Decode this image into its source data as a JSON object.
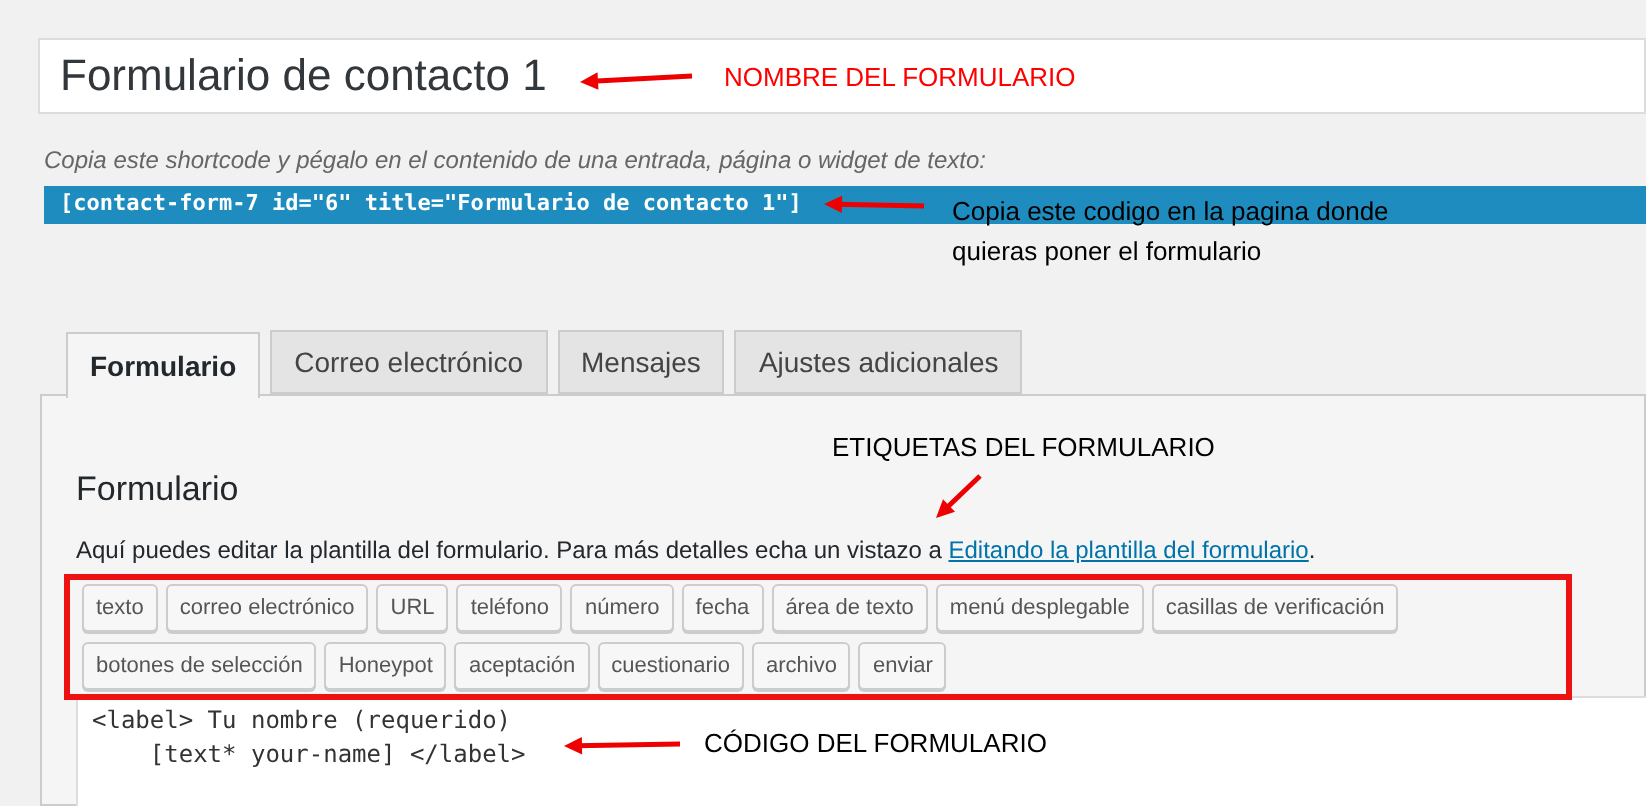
{
  "title_field": {
    "value": "Formulario de contacto 1"
  },
  "shortcode_hint": "Copia este shortcode y pégalo en el contenido de una entrada, página o widget de texto:",
  "shortcode": "[contact-form-7 id=\"6\" title=\"Formulario de contacto 1\"]",
  "tabs": [
    {
      "label": "Formulario",
      "selected": true
    },
    {
      "label": "Correo electrónico",
      "selected": false
    },
    {
      "label": "Mensajes",
      "selected": false
    },
    {
      "label": "Ajustes adicionales",
      "selected": false
    }
  ],
  "panel": {
    "heading": "Formulario",
    "description": "Aquí puedes editar la plantilla del formulario. Para más detalles echa un vistazo a ",
    "link": "Editando la plantilla del formulario",
    "description_end": "."
  },
  "tag_buttons": [
    "texto",
    "correo electrónico",
    "URL",
    "teléfono",
    "número",
    "fecha",
    "área de texto",
    "menú desplegable",
    "casillas de verificación",
    "botones de selección",
    "Honeypot",
    "aceptación",
    "cuestionario",
    "archivo",
    "enviar"
  ],
  "code_lines": [
    "<label> Tu nombre (requerido)",
    "    [text* your-name] </label>"
  ],
  "annotations": [
    {
      "text": "NOMBRE DEL FORMULARIO",
      "color": "#ff0000"
    },
    {
      "text": "Copia este codigo en la pagina donde quieras poner el formulario",
      "color": "#000000"
    },
    {
      "text": "ETIQUETAS DEL FORMULARIO",
      "color": "#000000"
    },
    {
      "text": "CÓDIGO DEL FORMULARIO",
      "color": "#000000"
    }
  ]
}
